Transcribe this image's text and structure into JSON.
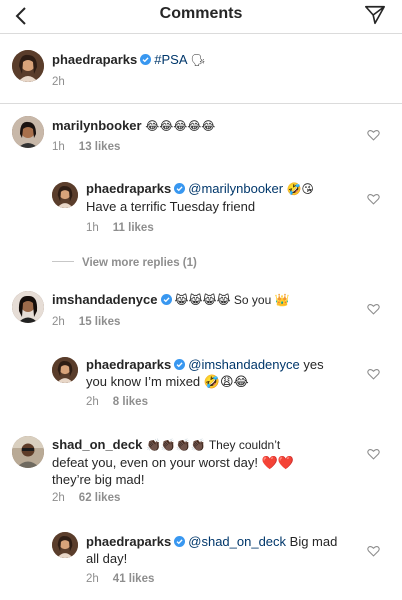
{
  "header": {
    "title": "Comments"
  },
  "caption": {
    "username": "phaedraparks",
    "text": "#PSA",
    "time": "2h"
  },
  "comments": [
    {
      "username": "marilynbooker",
      "text": "😂😂😂😂😂",
      "time": "1h",
      "likes": "13 likes",
      "reply": {
        "username": "phaedraparks",
        "mention": "@marilynbooker",
        "after": " 🤣😘",
        "line2": "Have a terrific Tuesday friend",
        "time": "1h",
        "likes": "11 likes"
      },
      "view_more": "View more replies (1)"
    },
    {
      "username": "imshandadenyce",
      "text": "😹😹😹😹 So you 👑",
      "time": "2h",
      "likes": "15 likes",
      "reply": {
        "username": "phaedraparks",
        "mention": "@imshandadenyce",
        "after": " yes",
        "line2": "you know I’m mixed 🤣😩😂",
        "time": "2h",
        "likes": "8 likes"
      }
    },
    {
      "username": "shad_on_deck",
      "text": "👏🏿👏🏿👏🏿👏🏿 They couldn’t",
      "line2": "defeat you, even on your worst day! ❤️❤️",
      "line3": "they’re big mad!",
      "time": "2h",
      "likes": "62 likes",
      "reply": {
        "username": "phaedraparks",
        "mention": "@shad_on_deck",
        "after": " Big mad",
        "line2": "all day!",
        "time": "2h",
        "likes": "41 likes"
      }
    }
  ],
  "icons": {
    "back": "chevron-left-icon",
    "send": "direct-send-icon",
    "heart": "heart-outline-icon",
    "verified": "verified-badge-icon"
  },
  "colors": {
    "verified": "#3897f0",
    "mention": "#00376b",
    "meta": "#8e8e8e"
  }
}
